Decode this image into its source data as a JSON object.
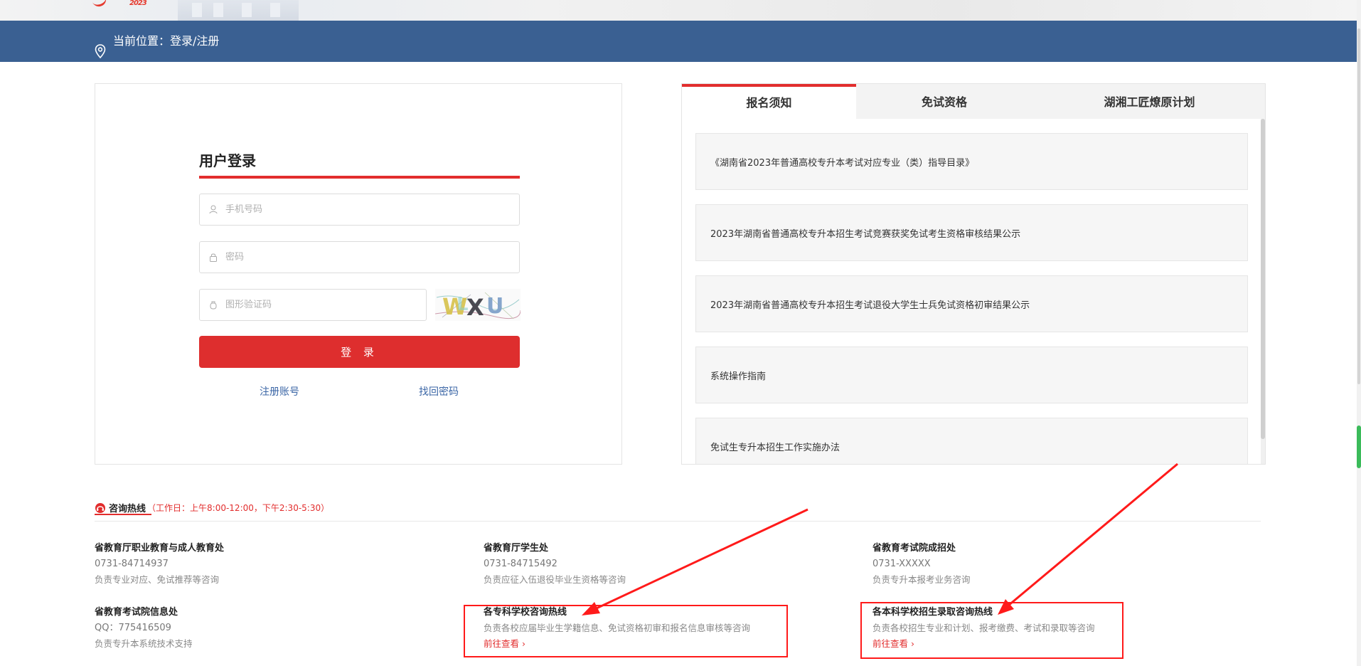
{
  "banner": {
    "logo_text": "2023"
  },
  "breadcrumb": {
    "text": "当前位置：登录/注册"
  },
  "login": {
    "title": "用户登录",
    "phone_placeholder": "手机号码",
    "password_placeholder": "密码",
    "captcha_placeholder": "图形验证码",
    "captcha_text": "WXU",
    "login_button": "登 录",
    "register_link": "注册账号",
    "forgot_link": "找回密码"
  },
  "notices": {
    "tabs": [
      {
        "label": "报名须知",
        "active": true
      },
      {
        "label": "免试资格",
        "active": false
      },
      {
        "label": "湖湘工匠燎原计划",
        "active": false
      }
    ],
    "items": [
      {
        "title": "《湖南省2023年普通高校专升本考试对应专业（类）指导目录》"
      },
      {
        "title": "2023年湖南省普通高校专升本招生考试竞赛获奖免试考生资格审核结果公示"
      },
      {
        "title": "2023年湖南省普通高校专升本招生考试退役大学生士兵免试资格初审结果公示"
      },
      {
        "title": "系统操作指南"
      },
      {
        "title": "免试生专升本招生工作实施办法"
      }
    ]
  },
  "hotline": {
    "title": "咨询热线",
    "hours": "（工作日：上午8:00-12:00，下午2:30-5:30）",
    "contacts": [
      {
        "name": "省教育厅职业教育与成人教育处",
        "phone": "0731-84714937",
        "desc": "负责专业对应、免试推荐等咨询"
      },
      {
        "name": "省教育厅学生处",
        "phone": "0731-84715492",
        "desc": "负责应征入伍退役毕业生资格等咨询"
      },
      {
        "name": "省教育考试院成招处",
        "phone": "0731-XXXXX",
        "desc": "负责专升本报考业务咨询"
      },
      {
        "name": "省教育考试院信息处",
        "phone": "QQ：775416509",
        "desc": "负责专升本系统技术支持"
      },
      {
        "name": "各专科学校咨询热线",
        "desc": "负责各校应届毕业生学籍信息、免试资格初审和报名信息审核等咨询",
        "more": "前往查看 ›"
      },
      {
        "name": "各本科学校招生录取咨询热线",
        "desc": "负责各校招生专业和计划、报考缴费、考试和录取等咨询",
        "more": "前往查看 ›"
      }
    ]
  },
  "colors": {
    "header_blue": "#3a6092",
    "accent_red": "#e22d2d",
    "annotation_red": "#ff1a1a"
  }
}
